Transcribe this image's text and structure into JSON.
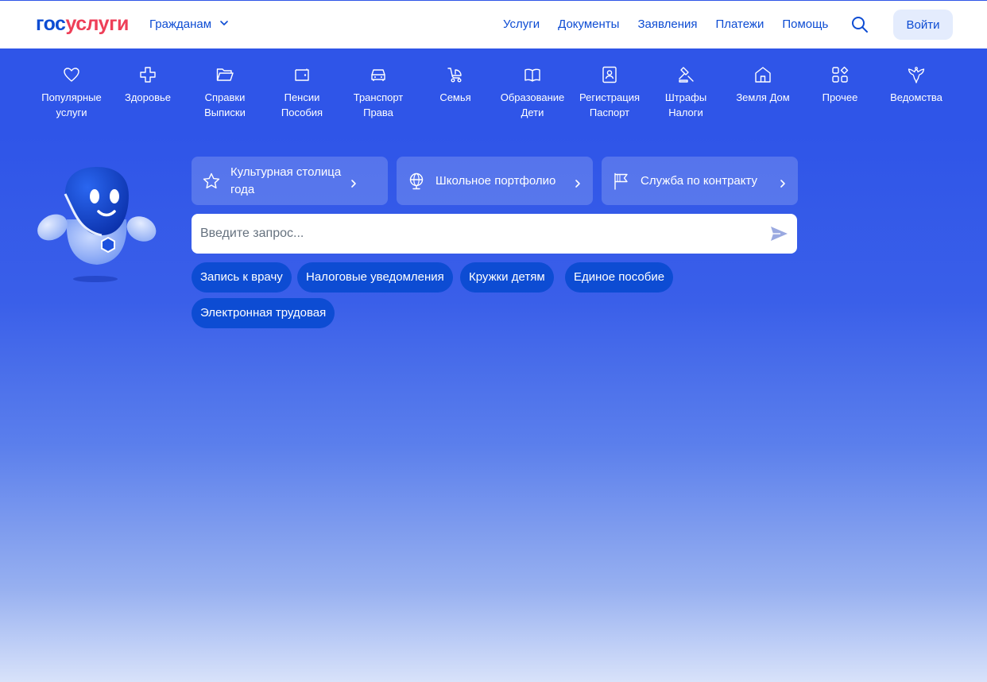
{
  "header": {
    "logo_part1": "гос",
    "logo_part2": "услуги",
    "audience": "Гражданам",
    "nav": [
      "Услуги",
      "Документы",
      "Заявления",
      "Платежи",
      "Помощь"
    ],
    "login": "Войти"
  },
  "categories": [
    {
      "icon": "heart-icon",
      "line1": "Популярные",
      "line2": "услуги"
    },
    {
      "icon": "medical-cross-icon",
      "line1": "Здоровье",
      "line2": ""
    },
    {
      "icon": "folder-icon",
      "line1": "Справки",
      "line2": "Выписки"
    },
    {
      "icon": "wallet-icon",
      "line1": "Пенсии",
      "line2": "Пособия"
    },
    {
      "icon": "car-icon",
      "line1": "Транспорт",
      "line2": "Права"
    },
    {
      "icon": "stroller-icon",
      "line1": "Семья",
      "line2": ""
    },
    {
      "icon": "book-icon",
      "line1": "Образование",
      "line2": "Дети"
    },
    {
      "icon": "passport-icon",
      "line1": "Регистрация",
      "line2": "Паспорт"
    },
    {
      "icon": "gavel-icon",
      "line1": "Штрафы",
      "line2": "Налоги"
    },
    {
      "icon": "house-icon",
      "line1": "Земля Дом",
      "line2": ""
    },
    {
      "icon": "grid-icon",
      "line1": "Прочее",
      "line2": ""
    },
    {
      "icon": "eagle-icon",
      "line1": "Ведомства",
      "line2": ""
    }
  ],
  "quick_links": [
    {
      "icon": "star-icon",
      "label": "Культурная столица года"
    },
    {
      "icon": "globe-icon",
      "label": "Школьное портфолио"
    },
    {
      "icon": "flag-icon",
      "label": "Служба по контракту"
    }
  ],
  "search": {
    "placeholder": "Введите запрос..."
  },
  "chips": [
    "Запись к врачу",
    "Налоговые уведомления",
    "Кружки детям",
    "Единое пособие",
    "Электронная трудовая"
  ],
  "colors": {
    "brand_blue": "#0d4cd3",
    "brand_red": "#ee3f58",
    "hero_blue": "#2f55e8",
    "chip_blue": "#0d4cd3"
  }
}
